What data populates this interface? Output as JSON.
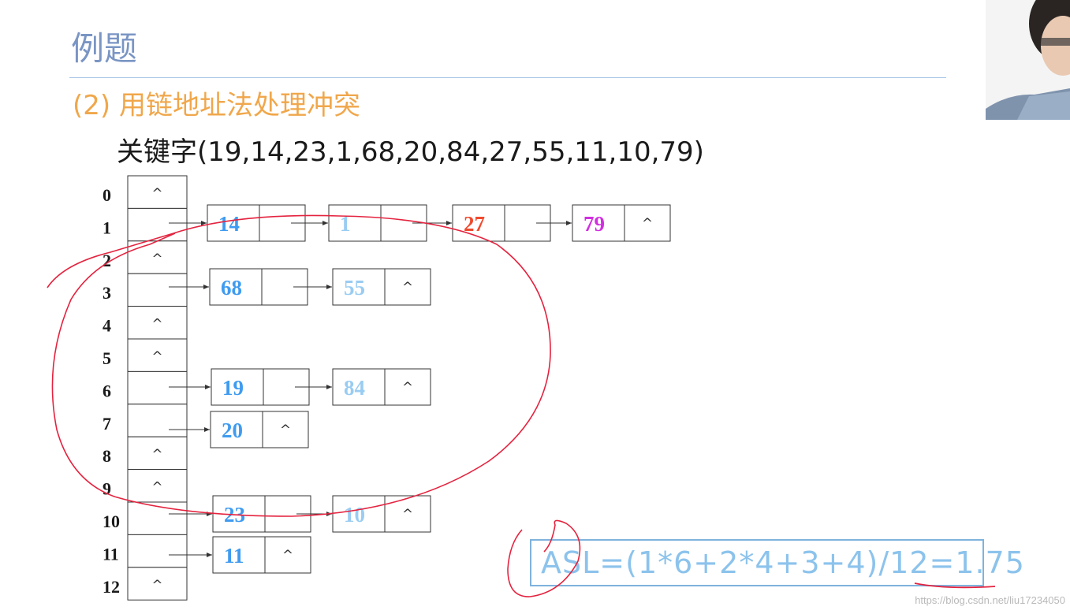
{
  "title": "例题",
  "subtitle": "(2)  用链地址法处理冲突",
  "keys_line": "关键字(19,14,23,1,68,20,84,27,55,11,10,79)",
  "null_symbol": "^",
  "colors": {
    "blue": "#3f9bf0",
    "light_blue": "#99ccf2",
    "red": "#f04a2e",
    "magenta": "#d12fe0",
    "annotation": "#e4233f"
  },
  "table": [
    {
      "index": "0",
      "chain": []
    },
    {
      "index": "1",
      "chain": [
        {
          "value": "14",
          "color": "blue"
        },
        {
          "value": "1",
          "color": "light_blue"
        },
        {
          "value": "27",
          "color": "red"
        },
        {
          "value": "79",
          "color": "magenta"
        }
      ]
    },
    {
      "index": "2",
      "chain": []
    },
    {
      "index": "3",
      "chain": [
        {
          "value": "68",
          "color": "blue"
        },
        {
          "value": "55",
          "color": "light_blue"
        }
      ]
    },
    {
      "index": "4",
      "chain": []
    },
    {
      "index": "5",
      "chain": []
    },
    {
      "index": "6",
      "chain": [
        {
          "value": "19",
          "color": "blue"
        },
        {
          "value": "84",
          "color": "light_blue"
        }
      ]
    },
    {
      "index": "7",
      "chain": [
        {
          "value": "20",
          "color": "blue"
        }
      ]
    },
    {
      "index": "8",
      "chain": []
    },
    {
      "index": "9",
      "chain": []
    },
    {
      "index": "10",
      "chain": [
        {
          "value": "23",
          "color": "blue"
        },
        {
          "value": "10",
          "color": "light_blue"
        }
      ]
    },
    {
      "index": "11",
      "chain": [
        {
          "value": "11",
          "color": "blue"
        }
      ]
    },
    {
      "index": "12",
      "chain": []
    }
  ],
  "asl": "ASL=(1*6+2*4+3+4)/12=1.75",
  "watermark": "https://blog.csdn.net/liu17234050"
}
